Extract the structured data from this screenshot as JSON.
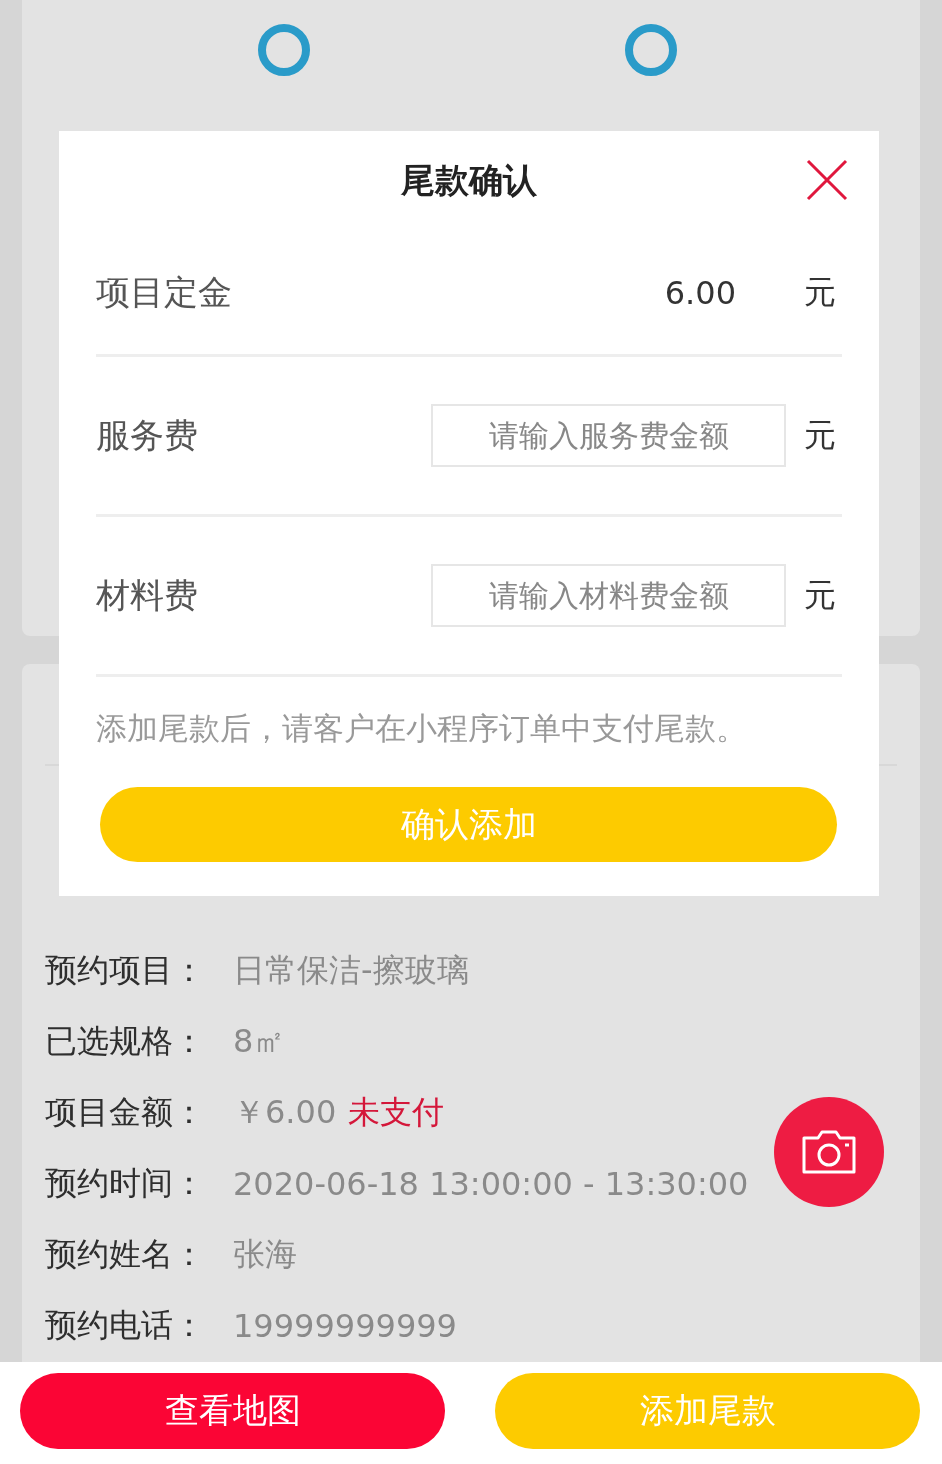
{
  "order": {
    "rows": [
      {
        "label": "预约项目：",
        "value": "日常保洁-擦玻璃"
      },
      {
        "label": "已选规格：",
        "value": "8㎡"
      },
      {
        "label": "项目金额：",
        "value": "￥6.00",
        "status": "未支付"
      },
      {
        "label": "预约时间：",
        "value": "2020-06-18 13:00:00 - 13:30:00"
      },
      {
        "label": "预约姓名：",
        "value": "张海"
      },
      {
        "label": "预约电话：",
        "value": "19999999999"
      }
    ]
  },
  "dialog": {
    "title": "尾款确认",
    "fields": [
      {
        "kind": "value",
        "label": "项目定金",
        "value": "6.00",
        "unit": "元"
      },
      {
        "kind": "input",
        "label": "服务费",
        "placeholder": "请输入服务费金额",
        "unit": "元"
      },
      {
        "kind": "input",
        "label": "材料费",
        "placeholder": "请输入材料费金额",
        "unit": "元"
      }
    ],
    "note": "添加尾款后，请客户在小程序订单中支付尾款。",
    "confirm_button": "确认添加"
  },
  "bottom_bar": {
    "buttons": [
      {
        "kind": "map",
        "label": "查看地图"
      },
      {
        "kind": "add",
        "label": "添加尾款"
      }
    ]
  }
}
